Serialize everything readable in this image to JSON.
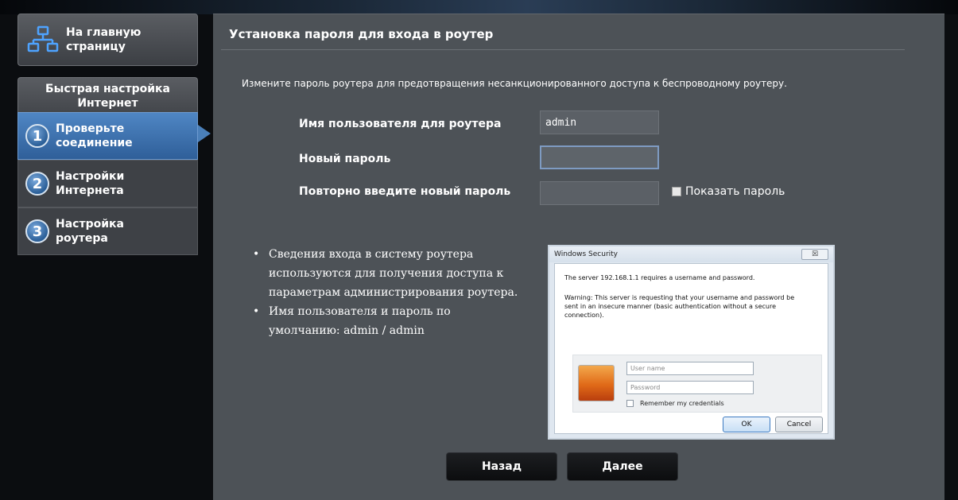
{
  "sidebar": {
    "home_label_1": "На главную",
    "home_label_2": "страницу",
    "qis_title_1": "Быстрая настройка",
    "qis_title_2": "Интернет",
    "steps": [
      {
        "number": "1",
        "line1": "Проверьте",
        "line2": "соединение"
      },
      {
        "number": "2",
        "line1": "Настройки",
        "line2": "Интернета"
      },
      {
        "number": "3",
        "line1": "Настройка",
        "line2": "роутера"
      }
    ],
    "active_step": 1
  },
  "main": {
    "title": "Установка пароля для входа в роутер",
    "description": "Измените пароль роутера для предотвращения несанкционированного доступа к беспроводному роутеру.",
    "fields": {
      "username_label": "Имя пользователя для роутера",
      "username_value": "admin",
      "new_password_label": "Новый пароль",
      "new_password_value": "",
      "confirm_password_label": "Повторно введите новый пароль",
      "confirm_password_value": ""
    },
    "show_password_label": "Показать пароль",
    "show_password_checked": false,
    "bullets": [
      [
        "Сведения входа в систему роутера",
        "используются для получения доступа к",
        "параметрам администрирования роутера."
      ],
      [
        "Имя пользователя и пароль по",
        "умолчанию: admin / admin"
      ]
    ]
  },
  "dialog": {
    "title": "Windows Security",
    "close_glyph": "☒",
    "server_text": "The server 192.168.1.1  requires a username and password.",
    "warning_line1": "Warning: This server is requesting that your username and password be",
    "warning_line2": "sent in an insecure manner (basic authentication without a secure",
    "warning_line3": "connection).",
    "username_placeholder": "User name",
    "password_placeholder": "Password",
    "remember_label": "Remember my credentials",
    "ok_label": "OK",
    "cancel_label": "Cancel"
  },
  "nav": {
    "back_label": "Назад",
    "next_label": "Далее"
  },
  "colors": {
    "active_step": "#3f74b3",
    "panel": "#4d5257",
    "background": "#0b0d10"
  }
}
